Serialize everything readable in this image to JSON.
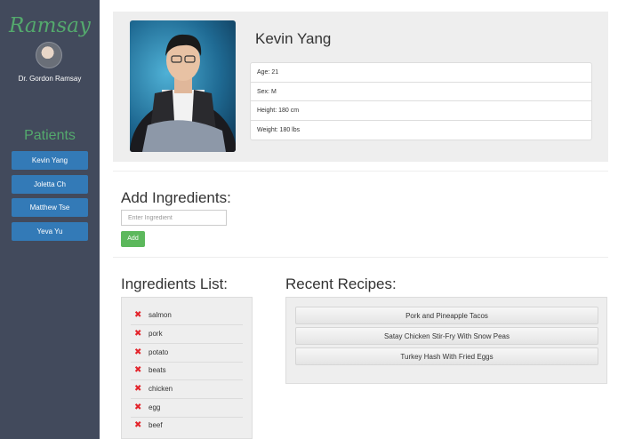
{
  "sidebar": {
    "brand": "Ramsay",
    "doctor_name": "Dr. Gordon Ramsay",
    "patients_heading": "Patients",
    "patients": [
      {
        "label": "Kevin Yang"
      },
      {
        "label": "Joletta Ch"
      },
      {
        "label": "Matthew Tse"
      },
      {
        "label": "Yeva Yu"
      }
    ]
  },
  "profile": {
    "name": "Kevin Yang",
    "info": [
      "Age: 21",
      "Sex: M",
      "Height: 180 cm",
      "Weight: 180 lbs"
    ]
  },
  "add_ingredients": {
    "title": "Add Ingredients:",
    "input_placeholder": "Enter Ingredient",
    "input_value": "",
    "add_label": "Add"
  },
  "ingredients": {
    "title": "Ingredients List:",
    "items": [
      "salmon",
      "pork",
      "potato",
      "beats",
      "chicken",
      "egg",
      "beef"
    ]
  },
  "recipes": {
    "title": "Recent Recipes:",
    "items": [
      "Pork and Pineapple Tacos",
      "Satay Chicken Stir-Fry With Snow Peas",
      "Turkey Hash With Fried Eggs"
    ]
  },
  "colors": {
    "sidebar_bg": "#424a5c",
    "brand_green": "#54a96d",
    "patient_button": "#337ab7",
    "add_button": "#5cb85c",
    "remove_icon": "#e3242b"
  }
}
